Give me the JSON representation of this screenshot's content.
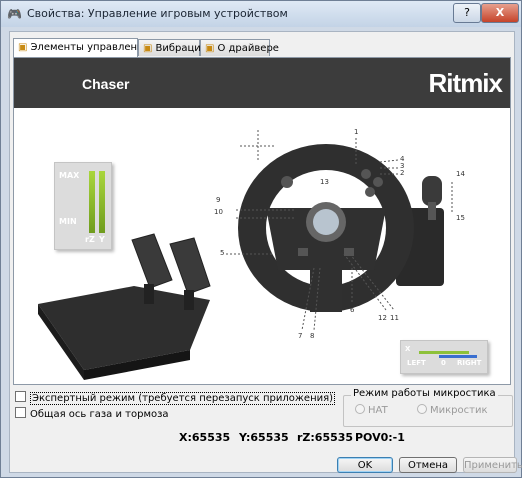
{
  "window": {
    "title": "Свойства: Управление игровым устройством",
    "help_label": "?",
    "close_label": "X"
  },
  "tabs": [
    {
      "label": "Элементы управления",
      "active": true
    },
    {
      "label": "Вибрация",
      "active": false
    },
    {
      "label": "О драйвере",
      "active": false
    }
  ],
  "banner": {
    "model": "Chaser",
    "brand": "Ritmix"
  },
  "meter": {
    "max_label": "MAX",
    "min_label": "MIN",
    "rz_label": "rZ",
    "y_label": "Y",
    "rz_level": 1.0,
    "y_level": 1.0
  },
  "x_indicator": {
    "axis_label": "X",
    "left_label": "LEFT",
    "center_label": "0",
    "right_label": "RIGHT"
  },
  "callouts": [
    "1",
    "2",
    "3",
    "4",
    "5",
    "6",
    "7",
    "8",
    "9",
    "10",
    "11",
    "12",
    "13",
    "14",
    "15"
  ],
  "options": {
    "expert_mode": {
      "label": "Экспертный режим (требуется перезапуск приложения)",
      "checked": false
    },
    "combined_axis": {
      "label": "Общая ось газа и тормоза",
      "checked": false
    }
  },
  "stick_mode": {
    "title": "Режим работы микростика",
    "hat_label": "HAT",
    "micro_label": "Микростик"
  },
  "axes": {
    "x": "X:65535",
    "y": "Y:65535",
    "rz": "rZ:65535",
    "pov": "POV0:-1"
  },
  "buttons": {
    "ok": "OK",
    "cancel": "Отмена",
    "apply": "Применить"
  },
  "colors": {
    "banner": "#3c3c3c",
    "level_bar": "#8dc13a",
    "x_bar": "#3a6fd0"
  }
}
